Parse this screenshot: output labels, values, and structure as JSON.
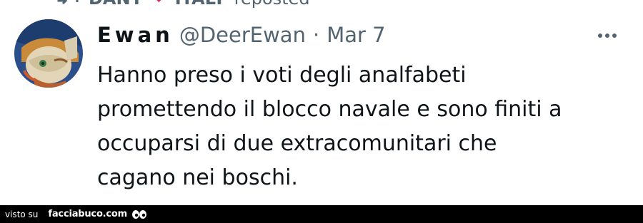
{
  "repost": {
    "name_part1": "DANY",
    "name_part2": "ITALY",
    "action": "reposted",
    "icons": [
      "repost-icon",
      "heart-icon"
    ]
  },
  "tweet": {
    "display_name": "Ewan",
    "handle": "@DeerEwan",
    "separator": "·",
    "date": "Mar 7",
    "text_lines": [
      "Hanno preso i voti degli analfabeti",
      "promettendo il blocco navale e sono finiti a",
      "occuparsi di due extracomunitari che",
      "cagano nei boschi."
    ],
    "more_icon": "more-horizontal-icon"
  },
  "watermark": {
    "prefix": "visto su",
    "site": "facciabuco.com",
    "logo_icon": "eyes-logo-icon"
  },
  "colors": {
    "text_primary": "#0f1419",
    "text_secondary": "#536471",
    "heart": "#e0245e",
    "watermark_bg": "#000000"
  }
}
